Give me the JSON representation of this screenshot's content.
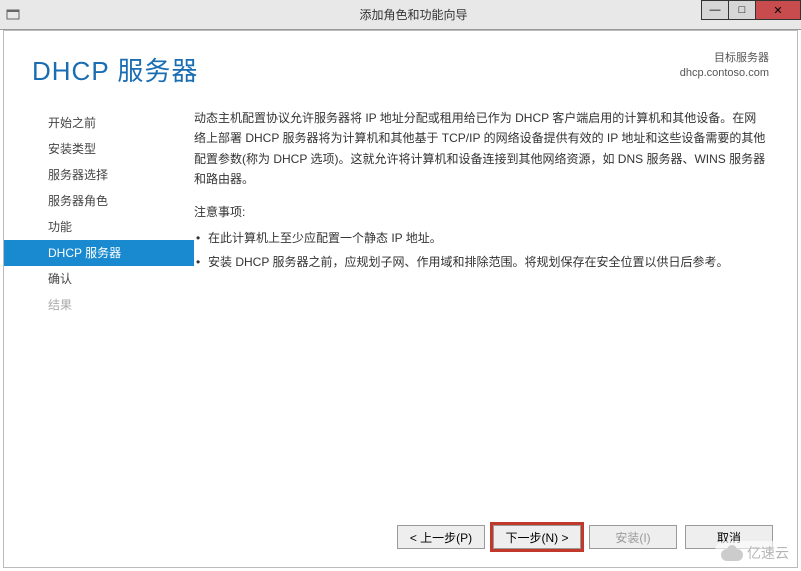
{
  "window": {
    "title": "添加角色和功能向导",
    "min": "—",
    "max": "□",
    "close": "✕"
  },
  "header": {
    "title": "DHCP 服务器",
    "target_label": "目标服务器",
    "target_value": "dhcp.contoso.com"
  },
  "sidebar": {
    "items": [
      {
        "label": "开始之前"
      },
      {
        "label": "安装类型"
      },
      {
        "label": "服务器选择"
      },
      {
        "label": "服务器角色"
      },
      {
        "label": "功能"
      },
      {
        "label": "DHCP 服务器",
        "active": true
      },
      {
        "label": "确认"
      },
      {
        "label": "结果",
        "disabled": true
      }
    ]
  },
  "body": {
    "description": "动态主机配置协议允许服务器将 IP 地址分配或租用给已作为 DHCP 客户端启用的计算机和其他设备。在网络上部署 DHCP 服务器将为计算机和其他基于 TCP/IP 的网络设备提供有效的 IP 地址和这些设备需要的其他配置参数(称为 DHCP 选项)。这就允许将计算机和设备连接到其他网络资源，如 DNS 服务器、WINS 服务器和路由器。",
    "notice_title": "注意事项:",
    "bullets": [
      "在此计算机上至少应配置一个静态 IP 地址。",
      "安装 DHCP 服务器之前，应规划子网、作用域和排除范围。将规划保存在安全位置以供日后参考。"
    ]
  },
  "buttons": {
    "prev": "< 上一步(P)",
    "next": "下一步(N) >",
    "install": "安装(I)",
    "cancel": "取消"
  },
  "watermark": "亿速云"
}
